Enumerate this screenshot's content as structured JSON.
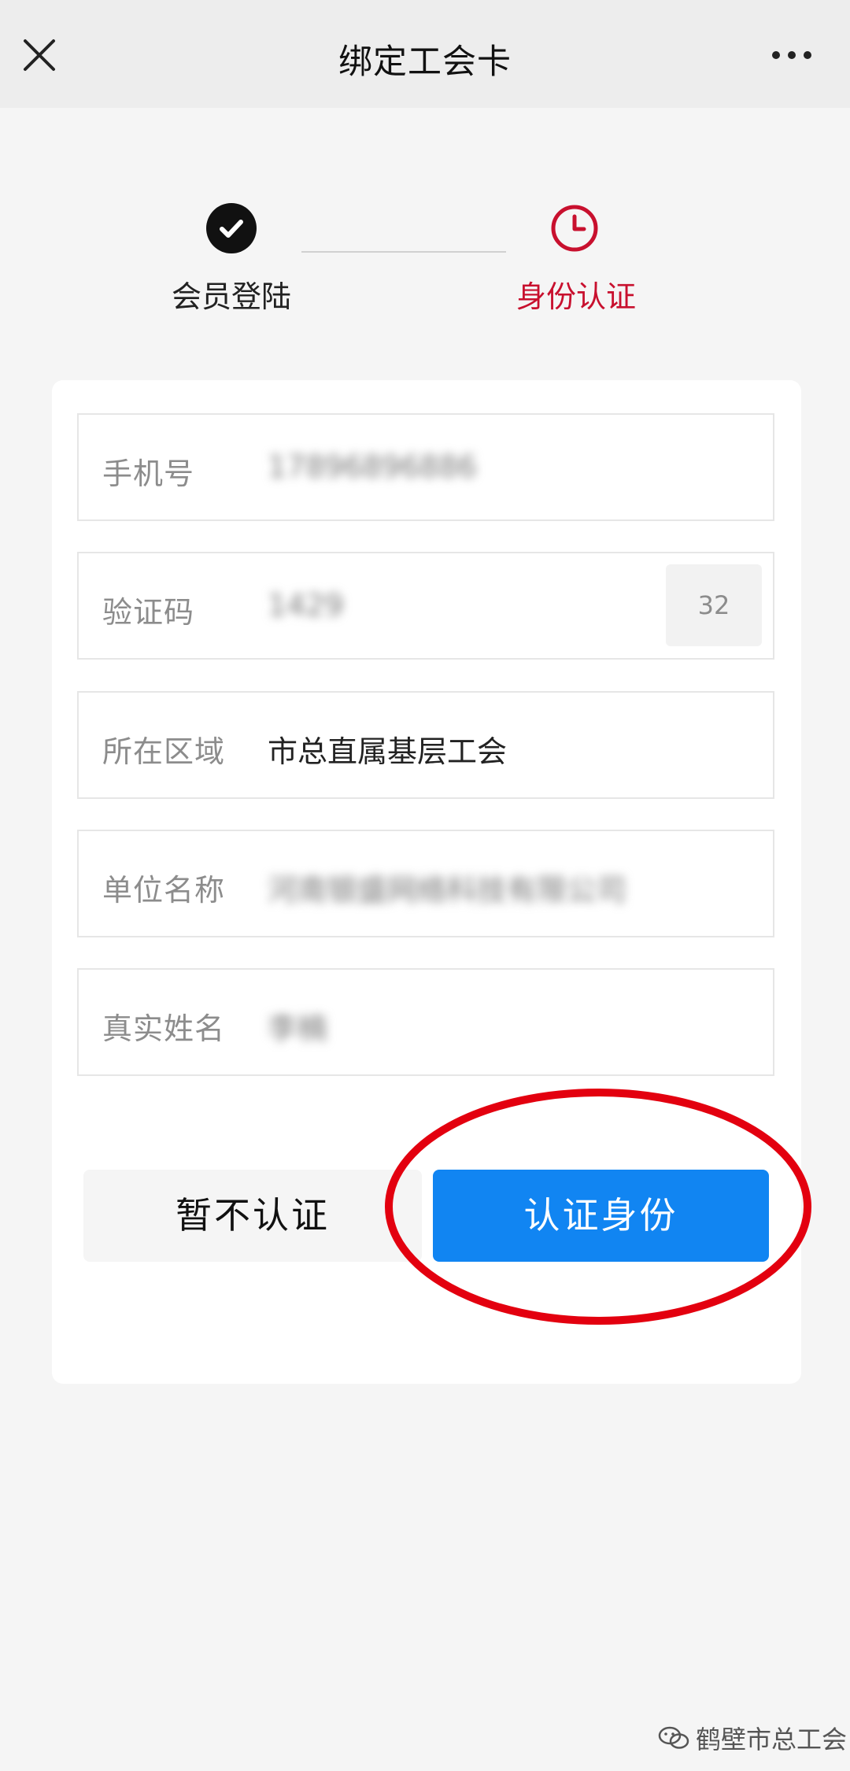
{
  "navbar": {
    "title": "绑定工会卡",
    "close_icon": "close-icon",
    "more_icon": "more-icon"
  },
  "steps": [
    {
      "label": "会员登陆",
      "status": "done",
      "icon": "check-icon"
    },
    {
      "label": "身份认证",
      "status": "current",
      "icon": "clock-icon"
    }
  ],
  "form": {
    "phone": {
      "label": "手机号",
      "value": "17896896886"
    },
    "code": {
      "label": "验证码",
      "value": "1429",
      "countdown": "32"
    },
    "region": {
      "label": "所在区域",
      "value": "市总直属基层工会"
    },
    "org": {
      "label": "单位名称",
      "value": "河南银盛网络科技有限公司"
    },
    "name": {
      "label": "真实姓名",
      "value": "李楠"
    }
  },
  "buttons": {
    "skip": "暂不认证",
    "verify": "认证身份"
  },
  "colors": {
    "accent": "#1185f2",
    "step_active": "#c8102e",
    "highlight": "#e3000f"
  },
  "watermark": {
    "text": "鹤壁市总工会",
    "logo_icon": "wechat-logo-icon"
  }
}
